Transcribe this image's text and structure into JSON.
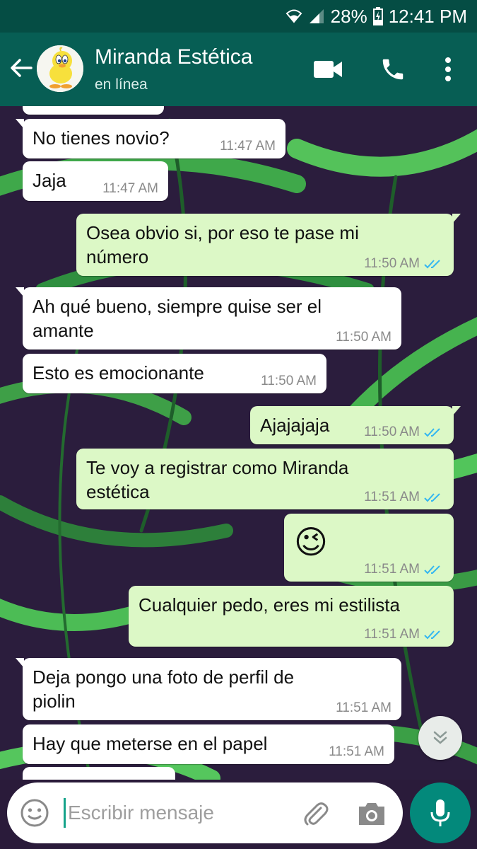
{
  "status_bar": {
    "battery": "28%",
    "time": "12:41 PM"
  },
  "header": {
    "contact_name": "Miranda Estética",
    "contact_status": "en línea",
    "icons": [
      "back-arrow-icon",
      "video-call-icon",
      "phone-icon",
      "more-vert-icon"
    ]
  },
  "messages": [
    {
      "dir": "in",
      "text": "No tienes novio?",
      "time": "11:47 AM"
    },
    {
      "dir": "in",
      "text": "Jaja",
      "time": "11:47 AM"
    },
    {
      "dir": "out",
      "text": "Osea obvio si, por eso te pase mi\nnúmero",
      "time": "11:50 AM",
      "read": true
    },
    {
      "dir": "in",
      "text": "Ah qué bueno, siempre quise ser el\namante",
      "time": "11:50 AM"
    },
    {
      "dir": "in",
      "text": "Esto es emocionante",
      "time": "11:50 AM"
    },
    {
      "dir": "out",
      "text": "Ajajajaja",
      "time": "11:50 AM",
      "read": true
    },
    {
      "dir": "out",
      "text": "Te voy a registrar como Miranda\nestética",
      "time": "11:51 AM",
      "read": true
    },
    {
      "dir": "out",
      "text": "😉",
      "time": "11:51 AM",
      "read": true,
      "emoji": true
    },
    {
      "dir": "out",
      "text": "Cualquier pedo, eres mi estilista",
      "time": "11:51 AM",
      "read": true
    },
    {
      "dir": "in",
      "text": "Deja pongo una foto de perfil de\npiolin",
      "time": "11:51 AM"
    },
    {
      "dir": "in",
      "text": "Hay que meterse en el papel",
      "time": "11:51 AM"
    }
  ],
  "input": {
    "placeholder": "Escribir mensaje"
  },
  "colors": {
    "header": "#075e54",
    "status_bar": "#054d44",
    "outgoing": "#dcf8c6",
    "incoming": "#ffffff",
    "read_ticks": "#34b7f1",
    "mic": "#03897b"
  }
}
